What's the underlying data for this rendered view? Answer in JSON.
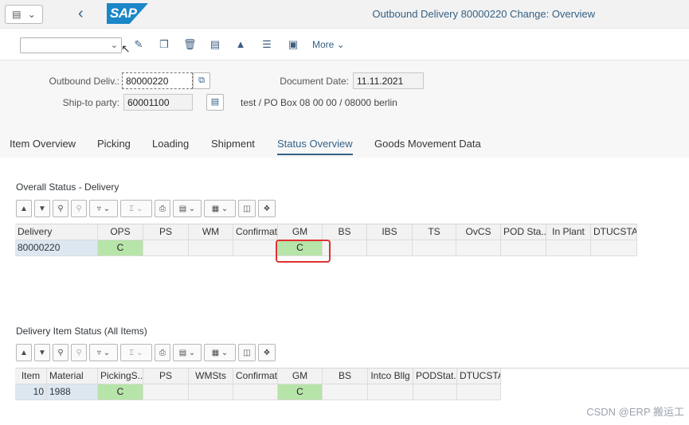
{
  "shell": {
    "logo": "SAP",
    "title": "Outbound Delivery 80000220 Change: Overview"
  },
  "toolbar": {
    "command_value": "",
    "more_label": "More"
  },
  "header": {
    "delivery_label": "Outbound Deliv.:",
    "delivery_value": "80000220",
    "docdate_label": "Document Date:",
    "docdate_value": "11.11.2021",
    "shipto_label": "Ship-to party:",
    "shipto_value": "60001100",
    "shipto_address": "test / PO Box 08 00 00 / 08000 berlin"
  },
  "tabs": [
    "Item Overview",
    "Picking",
    "Loading",
    "Shipment",
    "Status Overview",
    "Goods Movement Data"
  ],
  "selected_tab": "Status Overview",
  "overall": {
    "title": "Overall Status - Delivery",
    "columns": [
      "Delivery",
      "OPS",
      "PS",
      "WM",
      "Confirmat.",
      "GM",
      "BS",
      "IBS",
      "TS",
      "OvCS",
      "POD Sta...",
      "In Plant",
      "DTUCSTA"
    ],
    "row": [
      "80000220",
      "C",
      "",
      "",
      "",
      "C",
      "",
      "",
      "",
      "",
      "",
      "",
      ""
    ]
  },
  "items": {
    "title": "Delivery Item Status (All Items)",
    "columns": [
      "Item",
      "Material",
      "PickingS...",
      "PS",
      "WMSts",
      "Confirmat.",
      "GM",
      "BS",
      "Intco Bllg",
      "PODStat...",
      "DTUCSTA"
    ],
    "row": [
      "10",
      "1988",
      "C",
      "",
      "",
      "",
      "C",
      "",
      "",
      "",
      ""
    ]
  },
  "watermark": "CSDN @ERP 搬运工",
  "colors": {
    "accent": "#346187",
    "status_green": "#b7e4a8",
    "highlight": "#e03030"
  }
}
